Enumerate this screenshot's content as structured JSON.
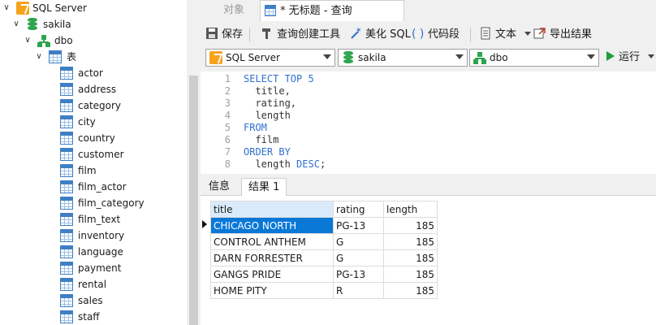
{
  "tree": {
    "server": "SQL Server",
    "database": "sakila",
    "schema": "dbo",
    "tables_folder": "表",
    "tables": [
      "actor",
      "address",
      "category",
      "city",
      "country",
      "customer",
      "film",
      "film_actor",
      "film_category",
      "film_text",
      "inventory",
      "language",
      "payment",
      "rental",
      "sales",
      "staff"
    ]
  },
  "tabs": {
    "objects": "对象",
    "query": "* 无标题 - 查询"
  },
  "toolbar": {
    "save": "保存",
    "query_builder": "查询创建工具",
    "beautify": "美化 SQL",
    "snippet": "代码段",
    "text": "文本",
    "export": "导出结果"
  },
  "selectors": {
    "connection": "SQL Server",
    "database": "sakila",
    "schema": "dbo",
    "run": "运行"
  },
  "editor": {
    "lines": [
      {
        "n": "1",
        "parts": [
          {
            "k": "kw",
            "t": "SELECT TOP "
          },
          {
            "k": "num",
            "t": "5"
          }
        ]
      },
      {
        "n": "2",
        "parts": [
          {
            "k": "tx",
            "t": "  title,"
          }
        ]
      },
      {
        "n": "3",
        "parts": [
          {
            "k": "tx",
            "t": "  rating,"
          }
        ]
      },
      {
        "n": "4",
        "parts": [
          {
            "k": "tx",
            "t": "  length"
          }
        ]
      },
      {
        "n": "5",
        "parts": [
          {
            "k": "kw",
            "t": "FROM"
          }
        ]
      },
      {
        "n": "6",
        "parts": [
          {
            "k": "tx",
            "t": "  film"
          }
        ]
      },
      {
        "n": "7",
        "parts": [
          {
            "k": "kw",
            "t": "ORDER BY"
          }
        ]
      },
      {
        "n": "8",
        "parts": [
          {
            "k": "tx",
            "t": "  length "
          },
          {
            "k": "kw",
            "t": "DESC"
          },
          {
            "k": "tx",
            "t": ";"
          }
        ]
      }
    ]
  },
  "results": {
    "tabs": [
      "信息",
      "结果 1"
    ],
    "columns": [
      "title",
      "rating",
      "length"
    ],
    "rows": [
      [
        "CHICAGO NORTH",
        "PG-13",
        "185"
      ],
      [
        "CONTROL ANTHEM",
        "G",
        "185"
      ],
      [
        "DARN FORRESTER",
        "G",
        "185"
      ],
      [
        "GANGS PRIDE",
        "PG-13",
        "185"
      ],
      [
        "HOME PITY",
        "R",
        "185"
      ]
    ]
  },
  "colors": {
    "keyword": "#2f6fcf",
    "selection": "#0a78d7",
    "db_green": "#2ea44f",
    "server_orange": "#f7a21b",
    "table_blue": "#3f7fc4",
    "run_green": "#1e9e3a"
  }
}
